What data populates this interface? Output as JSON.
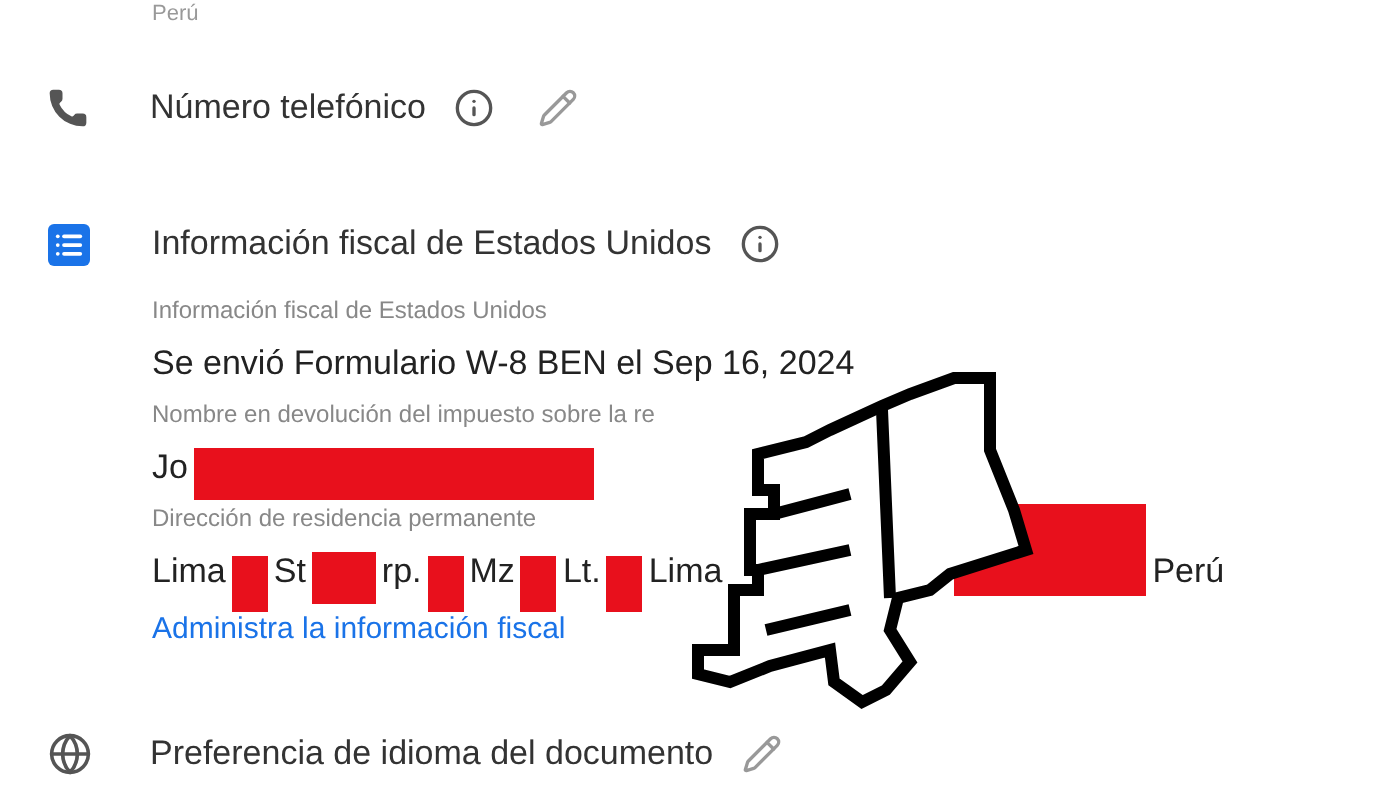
{
  "top_value": "Perú",
  "phone": {
    "label": "Número telefónico"
  },
  "tax": {
    "title": "Información fiscal de Estados Unidos",
    "fields": [
      {
        "label": "Información fiscal de Estados Unidos",
        "segments": [
          {
            "kind": "text",
            "text": "Se envió Formulario W-8 BEN el Sep 16, 2024"
          }
        ]
      },
      {
        "label": "Nombre en devolución del impuesto sobre la re",
        "segments": [
          {
            "kind": "text",
            "text": "Jo"
          },
          {
            "kind": "redacted_wide"
          }
        ]
      },
      {
        "label": "Dirección de residencia permanente",
        "segments": [
          {
            "kind": "text",
            "text": "Lima"
          },
          {
            "kind": "redacted"
          },
          {
            "kind": "text",
            "text": "St"
          },
          {
            "kind": "redacted_medium"
          },
          {
            "kind": "text",
            "text": "rp."
          },
          {
            "kind": "redacted"
          },
          {
            "kind": "text",
            "text": "Mz"
          },
          {
            "kind": "redacted"
          },
          {
            "kind": "text",
            "text": "Lt."
          },
          {
            "kind": "redacted"
          },
          {
            "kind": "text",
            "text": "Lima"
          },
          {
            "kind": "gap"
          },
          {
            "kind": "redacted_block"
          },
          {
            "kind": "text",
            "text": "Perú"
          }
        ]
      }
    ],
    "link": "Administra la información fiscal"
  },
  "language": {
    "label": "Preferencia de idioma del documento"
  }
}
